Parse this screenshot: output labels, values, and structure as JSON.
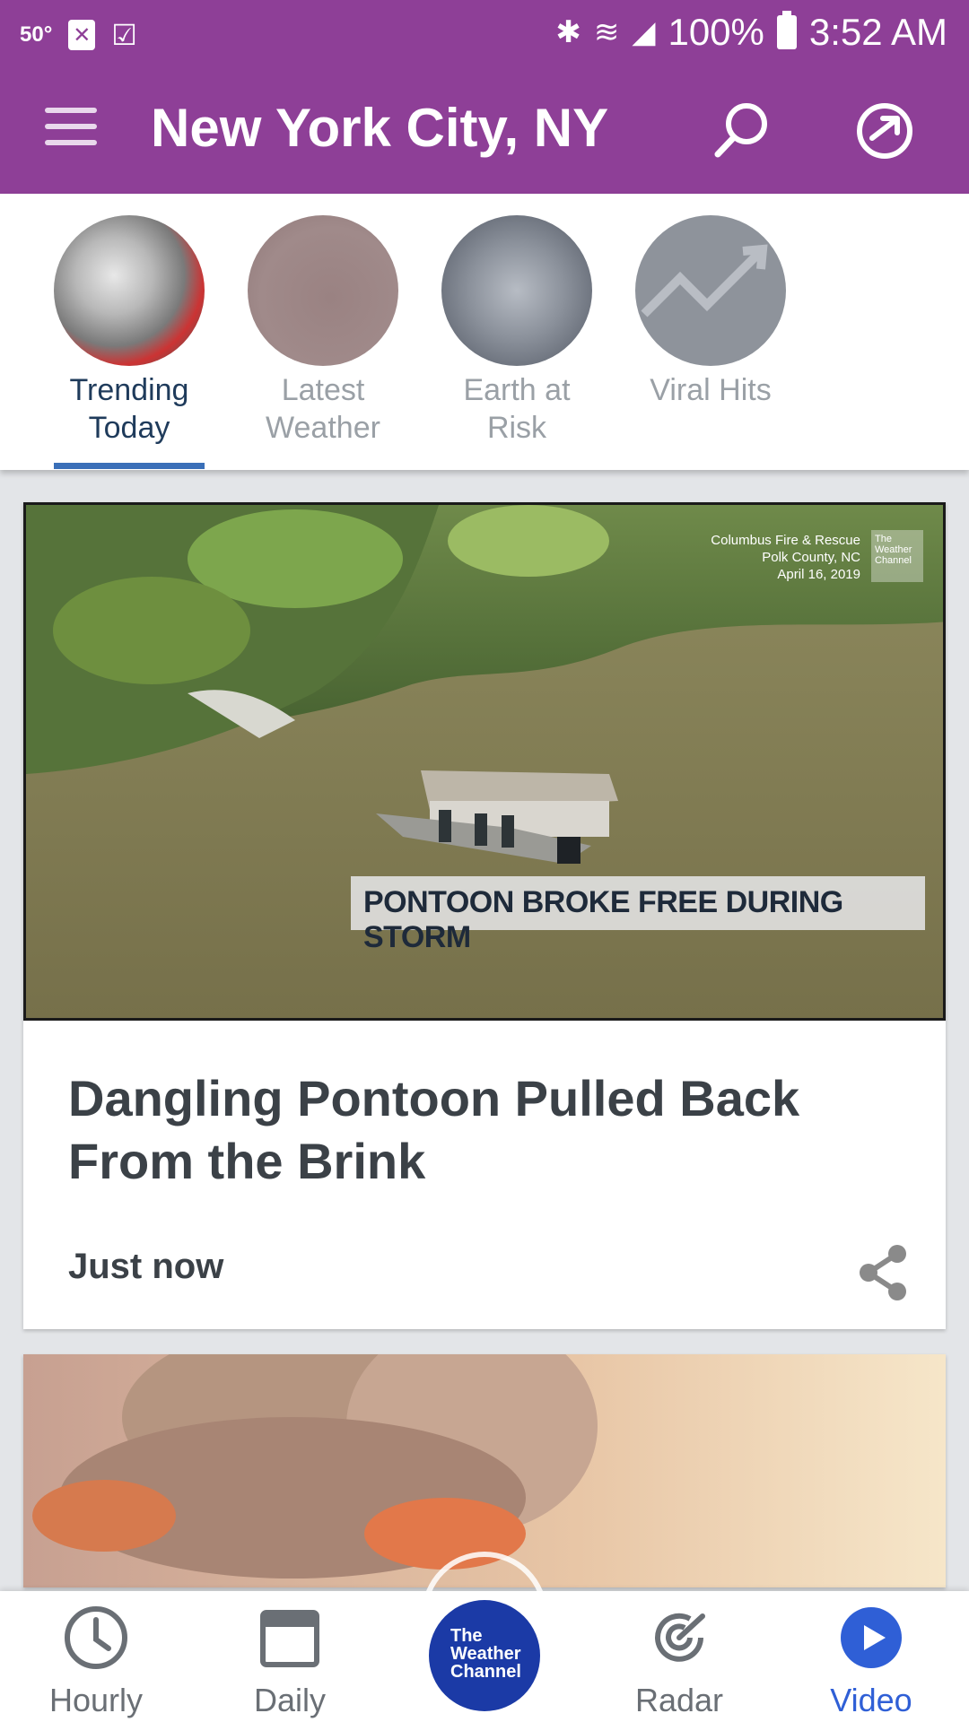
{
  "status_bar": {
    "temperature": "50°",
    "battery": "100%",
    "time": "3:52 AM"
  },
  "app_bar": {
    "title": "New York City, NY"
  },
  "categories": [
    {
      "label": "Trending Today",
      "active": true
    },
    {
      "label": "Latest Weather",
      "active": false
    },
    {
      "label": "Earth at Risk",
      "active": false
    },
    {
      "label": "Viral Hits",
      "active": false
    }
  ],
  "cards": [
    {
      "overlay_caption": "PONTOON BROKE FREE DURING STORM",
      "credit_lines": [
        "Columbus Fire & Rescue",
        "Polk County, NC",
        "April 16, 2019"
      ],
      "watermark": "The Weather Channel",
      "title": "Dangling Pontoon Pulled Back From the Brink",
      "time": "Just now"
    }
  ],
  "bottom_nav": {
    "items": [
      {
        "label": "Hourly",
        "icon": "clock-icon"
      },
      {
        "label": "Daily",
        "icon": "calendar-icon"
      },
      {
        "label": "Radar",
        "icon": "radar-icon"
      },
      {
        "label": "Video",
        "icon": "play-icon",
        "active": true
      }
    ],
    "logo": "The Weather Channel"
  },
  "colors": {
    "brand_purple": "#8e3f97",
    "active_blue": "#2f5fd6",
    "logo_blue": "#1b3aa6"
  }
}
